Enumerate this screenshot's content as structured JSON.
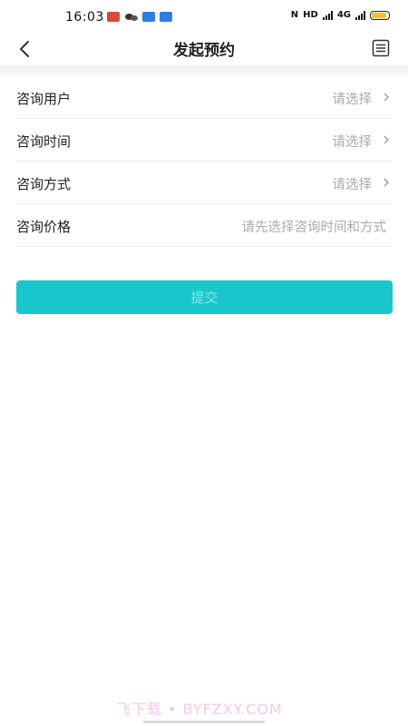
{
  "status_bar": {
    "time": "16:03",
    "network_label": "HD",
    "network_type": "4G"
  },
  "header": {
    "title": "发起预约"
  },
  "form": {
    "rows": [
      {
        "label": "咨询用户",
        "value": "请选择",
        "has_arrow": true
      },
      {
        "label": "咨询时间",
        "value": "请选择",
        "has_arrow": true
      },
      {
        "label": "咨询方式",
        "value": "请选择",
        "has_arrow": true
      },
      {
        "label": "咨询价格",
        "value": "请先选择咨询时间和方式",
        "has_arrow": false
      }
    ]
  },
  "submit": {
    "label": "提交"
  },
  "watermark": "飞下载 • BYFZXY.COM",
  "colors": {
    "accent": "#19c6cb",
    "placeholder": "#aaaaaa",
    "text": "#222222"
  }
}
